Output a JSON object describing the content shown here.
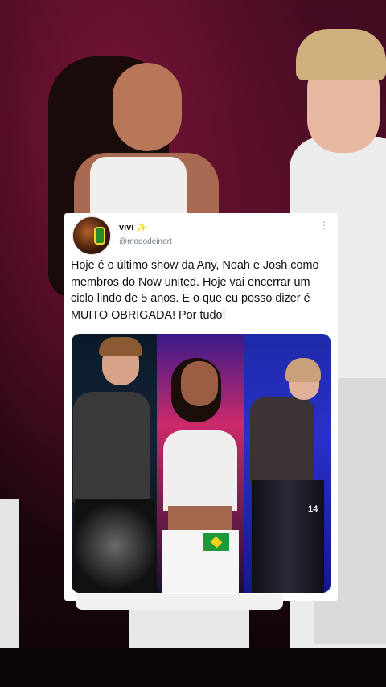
{
  "tweet": {
    "display_name": "vivi",
    "name_emoji": "✨",
    "handle": "@mododeinert",
    "more_icon": "⋮",
    "text": "Hoje é o último show da Any, Noah e Josh como membros do Now united. Hoje vai encerrar um ciclo lindo de 5 anos. E o que eu posso dizer é MUITO OBRIGADA! Por tudo!",
    "media_jersey_number": "14"
  },
  "colors": {
    "background": "#2a0714",
    "card": "#ffffff",
    "handle": "#6d7780"
  }
}
